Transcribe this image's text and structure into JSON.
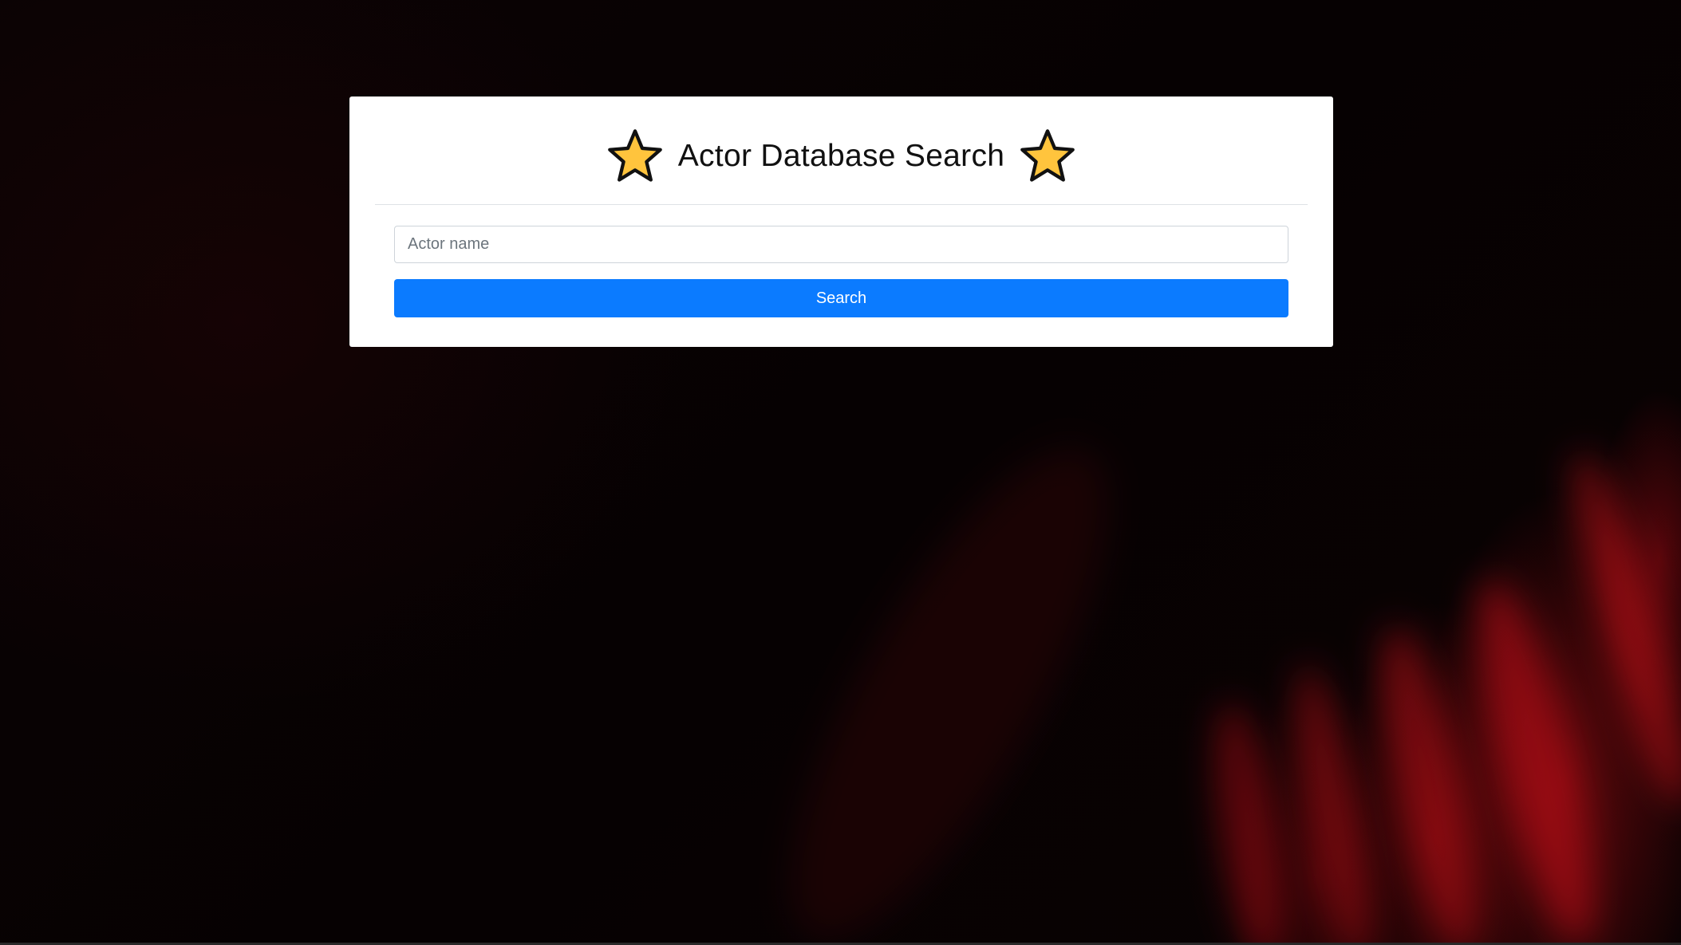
{
  "header": {
    "title": "Actor Database Search",
    "left_icon": "star-icon",
    "right_icon": "star-icon",
    "icon_color": "#FFC43D"
  },
  "search": {
    "placeholder": "Actor name",
    "value": "",
    "button_label": "Search"
  },
  "colors": {
    "button_bg": "#0B7BFF",
    "card_bg": "#FFFFFF",
    "page_bg": "#070203",
    "accent_glow": "#B00E16"
  }
}
